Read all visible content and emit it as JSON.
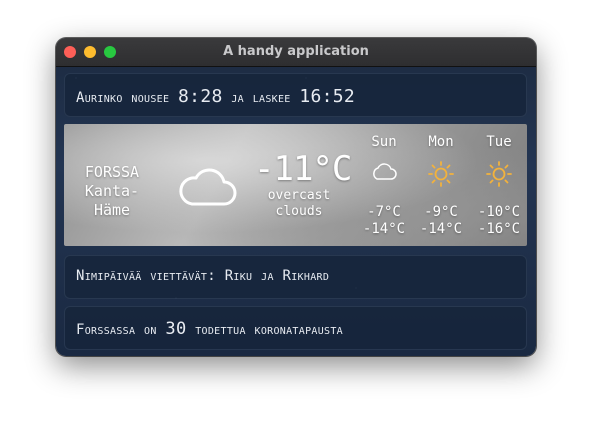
{
  "window": {
    "title": "A handy application"
  },
  "sun": {
    "text1": "Aurinko nousee ",
    "sunrise": "8:28",
    "text2": " ja laskee ",
    "sunset": "16:52"
  },
  "weather": {
    "city": "FORSSA",
    "region": "Kanta-Häme",
    "icon": "cloud-icon",
    "temperature": "-11°C",
    "condition_line1": "overcast",
    "condition_line2": "clouds",
    "forecast": [
      {
        "day": "Sun",
        "icon": "cloud-icon",
        "high": "-7°C",
        "low": "-14°C"
      },
      {
        "day": "Mon",
        "icon": "sun-icon",
        "high": "-9°C",
        "low": "-14°C"
      },
      {
        "day": "Tue",
        "icon": "sun-icon",
        "high": "-10°C",
        "low": "-16°C"
      }
    ]
  },
  "names": {
    "text1": "Nimipäivää viettävät: ",
    "name1": "Riku",
    "text2": " ja ",
    "name2": "Rikhard"
  },
  "covid": {
    "text1": "Forssassa on ",
    "count": "30",
    "text2": " todettua koronatapausta"
  },
  "colors": {
    "sun_icon": "#f3b23c",
    "panel_bg": "#16243a"
  }
}
